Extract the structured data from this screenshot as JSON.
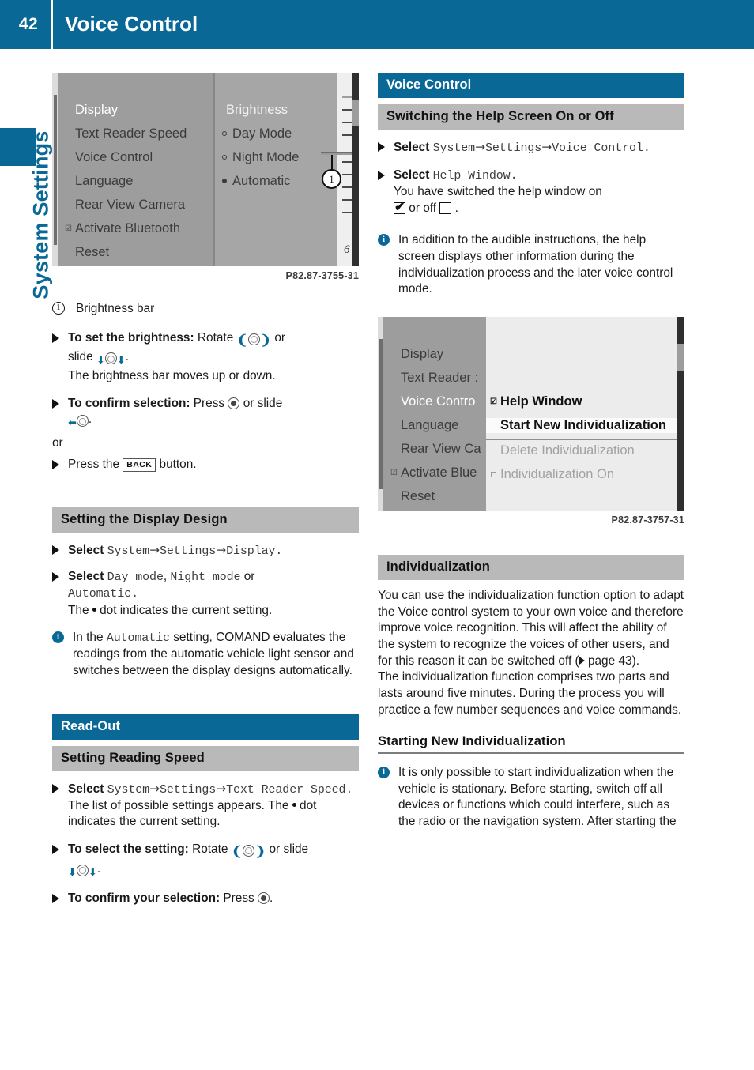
{
  "header": {
    "page_number": "42",
    "title": "Voice Control"
  },
  "side_tab": {
    "label": "System Settings"
  },
  "left_column": {
    "figure1": {
      "caption": "P82.87-3755-31",
      "menu_items": [
        "Display",
        "Text Reader Speed",
        "Voice Control",
        "Language",
        "Activate Bluetooth",
        "Rear View Camera",
        "Reset"
      ],
      "submenu_title": "Brightness",
      "submenu_options": [
        "Day Mode",
        "Night Mode",
        "Automatic"
      ],
      "selected_option": "Automatic",
      "scale_label": "6",
      "callout_number": "1"
    },
    "legend": {
      "number": "1",
      "text": "Brightness bar"
    },
    "step_brightness": {
      "bold": "To set the brightness:",
      "rest_a": "Rotate",
      "rest_b": "or",
      "rest_c": "slide",
      "rest_d": ".",
      "result": "The brightness bar moves up or down."
    },
    "step_confirm": {
      "bold": "To confirm selection:",
      "rest_a": "Press",
      "rest_b": "or slide",
      "rest_c": "."
    },
    "or_label": "or",
    "step_back": {
      "pre": "Press the",
      "button": "BACK",
      "post": "button."
    },
    "heading_display_design": "Setting the Display Design",
    "step_select_display": {
      "bold": "Select",
      "path": [
        "System",
        "Settings",
        "Display"
      ],
      "period": "."
    },
    "step_select_mode": {
      "bold": "Select",
      "opt1": "Day mode",
      "comma": ",",
      "opt2": "Night mode",
      "or": "or",
      "opt3": "Automatic",
      "period": ".",
      "result_a": "The",
      "result_b": "dot indicates the current setting."
    },
    "note_automatic": {
      "pre": "In the",
      "mono": "Automatic",
      "post": "setting, COMAND evaluates the readings from the automatic vehicle light sensor and switches between the display designs automatically."
    },
    "heading_readout": "Read-Out",
    "heading_reading_speed": "Setting Reading Speed",
    "step_select_textreader": {
      "bold": "Select",
      "path": [
        "System",
        "Settings",
        "Text Reader Speed"
      ],
      "period": ".",
      "result_a": "The list of possible settings appears. The",
      "result_b": "dot indicates the current setting."
    },
    "step_select_setting": {
      "bold": "To select the setting:",
      "rest_a": "Rotate",
      "rest_b": "or slide",
      "rest_c": "."
    },
    "step_confirm_selection": {
      "bold": "To confirm your selection:",
      "rest_a": "Press",
      "rest_b": "."
    }
  },
  "right_column": {
    "heading_voice_control": "Voice Control",
    "heading_help_screen": "Switching the Help Screen On or Off",
    "step_select_voice": {
      "bold": "Select",
      "path": [
        "System",
        "Settings",
        "Voice Control"
      ],
      "period": "."
    },
    "step_select_help": {
      "bold": "Select",
      "mono": "Help Window",
      "period": ".",
      "result_a": "You have switched the help window on",
      "result_b": "or off",
      "result_c": "."
    },
    "note_help": "In addition to the audible instructions, the help screen displays other information during the individualization process and the later voice control mode.",
    "figure2": {
      "caption": "P82.87-3757-31",
      "menu_items": [
        "Display",
        "Text Reader :",
        "Voice Contro",
        "Language",
        "Rear View Ca",
        "Activate Blue",
        "Reset"
      ],
      "popup_items": [
        "Help Window",
        "Start New Individualization",
        "Delete Individualization",
        "Individualization On"
      ],
      "highlighted_item": "Start New Individualization"
    },
    "heading_individualization": "Individualization",
    "para_individualization_a_pre": "You can use the individualization function option to adapt the Voice control system to your own voice and therefore improve voice recognition. This will affect the ability of the system to recognize the voices of other users, and for this reason it can be switched off (",
    "para_individualization_a_ref": "page 43",
    "para_individualization_a_post": ").",
    "para_individualization_b": "The individualization function comprises two parts and lasts around five minutes. During the process you will practice a few number sequences and voice commands.",
    "heading_starting_new": "Starting New Individualization",
    "note_starting": "It is only possible to start individualization when the vehicle is stationary. Before starting, switch off all devices or functions which could interfere, such as the radio or the navigation system. After starting the"
  },
  "colors": {
    "brand_blue": "#0a6896",
    "header_gray": "#b9b9b9",
    "text": "#1a1a1a",
    "mono_gray": "#3c3c3c"
  },
  "icons": {
    "rotate_left": "❨",
    "rotate_right": "❩",
    "arrow_up": "⬆",
    "arrow_down": "⬇",
    "arrow_left": "⬅",
    "arrow_right": "→",
    "triangle_bullet": "▶",
    "check": "✔",
    "info": "i"
  }
}
